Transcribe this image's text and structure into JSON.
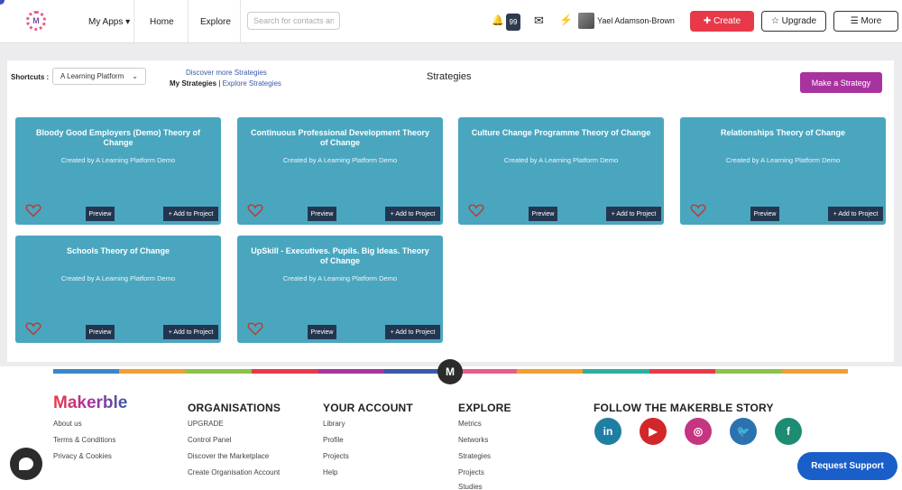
{
  "header": {
    "nav": {
      "apps": "My Apps ▾",
      "home": "Home",
      "explore": "Explore"
    },
    "search_placeholder": "Search for contacts an",
    "notification_count": "99",
    "user_name": "Yael Adamson-Brown",
    "create_label": "✚ Create",
    "upgrade_label": "☆ Upgrade",
    "more_label": "☰ More",
    "logo_letter": "M"
  },
  "toolbar": {
    "shortcuts_label": "Shortcuts :",
    "shortcuts_value": "A Learning Platform",
    "discover_link": "Discover more Strategies",
    "my_strategies": "My Strategies",
    "separator": " | ",
    "explore_link": "Explore Strategies",
    "title": "Strategies",
    "make_button": "Make a Strategy"
  },
  "cards": [
    {
      "title": "Bloody Good Employers (Demo) Theory of Change",
      "author": "Created by A Learning Platform Demo",
      "preview": "Preview",
      "add": "+ Add to Project"
    },
    {
      "title": "Continuous Professional Development Theory of Change",
      "author": "Created by A Learning Platform Demo",
      "preview": "Preview",
      "add": "+ Add to Project"
    },
    {
      "title": "Culture Change Programme Theory of Change",
      "author": "Created by A Learning Platform Demo",
      "preview": "Preview",
      "add": "+ Add to Project"
    },
    {
      "title": "Relationships Theory of Change",
      "author": "Created by A Learning Platform Demo",
      "preview": "Preview",
      "add": "+ Add to Project"
    },
    {
      "title": "Schools Theory of Change",
      "author": "Created by A Learning Platform Demo",
      "preview": "Preview",
      "add": "+ Add to Project"
    },
    {
      "title": "UpSkill - Executives. Pupils. Big Ideas. Theory of Change",
      "author": "Created by A Learning Platform Demo",
      "preview": "Preview",
      "add": "+ Add to Project"
    }
  ],
  "footer": {
    "logo": "Makerble",
    "m_badge": "M",
    "about": [
      "About us",
      "Terms & Conditions",
      "Privacy & Cookies"
    ],
    "organisations": {
      "title": "ORGANISATIONS",
      "links": [
        "UPGRADE",
        "Control Panel",
        "Discover the Marketplace",
        "Create Organisation Account"
      ]
    },
    "account": {
      "title": "YOUR ACCOUNT",
      "links": [
        "Library",
        "Profile",
        "Projects",
        "Help"
      ]
    },
    "explore": {
      "title": "EXPLORE",
      "links": [
        "Metrics",
        "Networks",
        "Strategies",
        "Projects",
        "Studies"
      ]
    },
    "follow": {
      "title": "FOLLOW THE MAKERBLE STORY"
    },
    "social": [
      {
        "name": "linkedin-icon",
        "glyph": "in",
        "color": "#1f7fa3"
      },
      {
        "name": "youtube-icon",
        "glyph": "▶",
        "color": "#d3262a"
      },
      {
        "name": "instagram-icon",
        "glyph": "◎",
        "color": "#c63580"
      },
      {
        "name": "twitter-icon",
        "glyph": "🐦",
        "color": "#2b72b0"
      },
      {
        "name": "facebook-icon",
        "glyph": "f",
        "color": "#1d8c72"
      }
    ],
    "request_support": "Request Support"
  },
  "colors": {
    "accent_create": "#e8394a",
    "accent_make": "#a8339f",
    "card": "#4aa6bf",
    "card_button": "#24364f",
    "strip": [
      "#3a86c8",
      "#f0a030",
      "#8bc34a",
      "#e8394a",
      "#a8339f",
      "#3a5aa8",
      "#e85c8a",
      "#f0a030",
      "#2bb0a0",
      "#e8394a",
      "#8bc34a",
      "#f0a030"
    ]
  }
}
